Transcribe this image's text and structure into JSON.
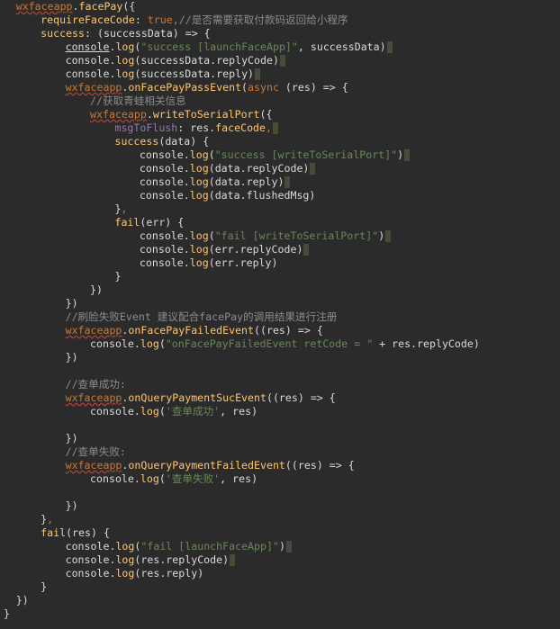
{
  "colors": {
    "background": "#2b2b2b",
    "keyword": "#cc7832",
    "string": "#6a8759",
    "comment": "#8c8c8c",
    "property": "#ffc66d",
    "plain": "#dadada"
  },
  "lines": [
    {
      "indent": 2,
      "tokens": [
        [
          "wxfaceapp",
          "t-obj"
        ],
        [
          ".",
          "t-plain"
        ],
        [
          "facePay",
          "t-prop"
        ],
        [
          "({",
          "t-plain"
        ]
      ]
    },
    {
      "indent": 6,
      "tokens": [
        [
          "requireFaceCode",
          "t-prop"
        ],
        [
          ": ",
          "t-plain"
        ],
        [
          "true",
          "t-kw"
        ],
        [
          ",",
          "t-kw"
        ],
        [
          "//是否需要获取付款码返回给小程序",
          "t-com"
        ]
      ]
    },
    {
      "indent": 6,
      "tokens": [
        [
          "success",
          "t-prop"
        ],
        [
          ": (successData) => {",
          "t-plain"
        ]
      ]
    },
    {
      "indent": 10,
      "tokens": [
        [
          "console",
          "t-consoleu"
        ],
        [
          ".",
          "t-plain"
        ],
        [
          "log",
          "t-prop"
        ],
        [
          "(",
          "t-plain"
        ],
        [
          "\"success [launchFaceApp]\"",
          "t-str"
        ],
        [
          ", successData)",
          "t-plain"
        ]
      ],
      "mark": true
    },
    {
      "indent": 10,
      "tokens": [
        [
          "console",
          "t-console"
        ],
        [
          ".",
          "t-plain"
        ],
        [
          "log",
          "t-prop"
        ],
        [
          "(successData.replyCode)",
          "t-plain"
        ]
      ],
      "mark": true
    },
    {
      "indent": 10,
      "tokens": [
        [
          "console",
          "t-console"
        ],
        [
          ".",
          "t-plain"
        ],
        [
          "log",
          "t-prop"
        ],
        [
          "(successData.reply)",
          "t-plain"
        ]
      ],
      "mark": true
    },
    {
      "indent": 10,
      "tokens": [
        [
          "wxfaceapp",
          "t-obj"
        ],
        [
          ".",
          "t-plain"
        ],
        [
          "onFacePayPassEvent",
          "t-prop"
        ],
        [
          "(",
          "t-plain"
        ],
        [
          "async",
          "t-kw"
        ],
        [
          " (res) => {",
          "t-plain"
        ]
      ]
    },
    {
      "indent": 14,
      "tokens": [
        [
          "//获取青蛙相关信息",
          "t-com"
        ]
      ]
    },
    {
      "indent": 14,
      "tokens": [
        [
          "wxfaceapp",
          "t-obj"
        ],
        [
          ".",
          "t-plain"
        ],
        [
          "writeToSerialPort",
          "t-prop"
        ],
        [
          "({",
          "t-plain"
        ]
      ]
    },
    {
      "indent": 18,
      "tokens": [
        [
          "msgToFlush",
          "t-key"
        ],
        [
          ": res.",
          "t-plain"
        ],
        [
          "faceCode",
          "t-prop"
        ],
        [
          ",",
          "t-kw"
        ]
      ],
      "mark": true
    },
    {
      "indent": 18,
      "tokens": [
        [
          "success",
          "t-prop"
        ],
        [
          "(data) {",
          "t-plain"
        ]
      ]
    },
    {
      "indent": 22,
      "tokens": [
        [
          "console",
          "t-console"
        ],
        [
          ".",
          "t-plain"
        ],
        [
          "log",
          "t-prop"
        ],
        [
          "(",
          "t-plain"
        ],
        [
          "\"success [writeToSerialPort]\"",
          "t-str"
        ],
        [
          ")",
          "t-plain"
        ]
      ],
      "mark": true
    },
    {
      "indent": 22,
      "tokens": [
        [
          "console",
          "t-console"
        ],
        [
          ".",
          "t-plain"
        ],
        [
          "log",
          "t-prop"
        ],
        [
          "(data.replyCode)",
          "t-plain"
        ]
      ],
      "mark": true
    },
    {
      "indent": 22,
      "tokens": [
        [
          "console",
          "t-console"
        ],
        [
          ".",
          "t-plain"
        ],
        [
          "log",
          "t-prop"
        ],
        [
          "(data.reply)",
          "t-plain"
        ]
      ],
      "mark": true
    },
    {
      "indent": 22,
      "tokens": [
        [
          "console",
          "t-console"
        ],
        [
          ".",
          "t-plain"
        ],
        [
          "log",
          "t-prop"
        ],
        [
          "(data.flushedMsg)",
          "t-plain"
        ]
      ]
    },
    {
      "indent": 18,
      "tokens": [
        [
          "}",
          "t-plain"
        ],
        [
          ",",
          "t-kw"
        ]
      ]
    },
    {
      "indent": 18,
      "tokens": [
        [
          "fail",
          "t-prop"
        ],
        [
          "(err) {",
          "t-plain"
        ]
      ]
    },
    {
      "indent": 22,
      "tokens": [
        [
          "console",
          "t-console"
        ],
        [
          ".",
          "t-plain"
        ],
        [
          "log",
          "t-prop"
        ],
        [
          "(",
          "t-plain"
        ],
        [
          "\"fail [writeToSerialPort]\"",
          "t-str"
        ],
        [
          ")",
          "t-plain"
        ]
      ],
      "mark": true
    },
    {
      "indent": 22,
      "tokens": [
        [
          "console",
          "t-console"
        ],
        [
          ".",
          "t-plain"
        ],
        [
          "log",
          "t-prop"
        ],
        [
          "(err.replyCode)",
          "t-plain"
        ]
      ],
      "mark": true
    },
    {
      "indent": 22,
      "tokens": [
        [
          "console",
          "t-console"
        ],
        [
          ".",
          "t-plain"
        ],
        [
          "log",
          "t-prop"
        ],
        [
          "(err.reply)",
          "t-plain"
        ]
      ]
    },
    {
      "indent": 18,
      "tokens": [
        [
          "}",
          "t-plain"
        ]
      ]
    },
    {
      "indent": 14,
      "tokens": [
        [
          "})",
          "t-plain"
        ]
      ]
    },
    {
      "indent": 10,
      "tokens": [
        [
          "})",
          "t-plain"
        ]
      ]
    },
    {
      "indent": 10,
      "tokens": [
        [
          "//刷脸失败Event 建议配合facePay的调用结果进行注册",
          "t-com"
        ]
      ]
    },
    {
      "indent": 10,
      "tokens": [
        [
          "wxfaceapp",
          "t-obj"
        ],
        [
          ".",
          "t-plain"
        ],
        [
          "onFacePayFailedEvent",
          "t-prop"
        ],
        [
          "((res) => {",
          "t-plain"
        ]
      ]
    },
    {
      "indent": 14,
      "tokens": [
        [
          "console",
          "t-console"
        ],
        [
          ".",
          "t-plain"
        ],
        [
          "log",
          "t-prop"
        ],
        [
          "(",
          "t-plain"
        ],
        [
          "\"onFacePayFailedEvent retCode = \"",
          "t-str"
        ],
        [
          " + res.replyCode)",
          "t-plain"
        ]
      ]
    },
    {
      "indent": 10,
      "tokens": [
        [
          "})",
          "t-plain"
        ]
      ]
    },
    {
      "indent": 0,
      "tokens": []
    },
    {
      "indent": 10,
      "tokens": [
        [
          "//查单成功:",
          "t-com"
        ]
      ]
    },
    {
      "indent": 10,
      "tokens": [
        [
          "wxfaceapp",
          "t-obj"
        ],
        [
          ".",
          "t-plain"
        ],
        [
          "onQueryPaymentSucEvent",
          "t-prop"
        ],
        [
          "((res) => {",
          "t-plain"
        ]
      ]
    },
    {
      "indent": 14,
      "tokens": [
        [
          "console",
          "t-console"
        ],
        [
          ".",
          "t-plain"
        ],
        [
          "log",
          "t-prop"
        ],
        [
          "(",
          "t-plain"
        ],
        [
          "'查单成功'",
          "t-str"
        ],
        [
          ", res)",
          "t-plain"
        ]
      ]
    },
    {
      "indent": 0,
      "tokens": []
    },
    {
      "indent": 10,
      "tokens": [
        [
          "})",
          "t-plain"
        ]
      ]
    },
    {
      "indent": 10,
      "tokens": [
        [
          "//查单失败:",
          "t-com"
        ]
      ]
    },
    {
      "indent": 10,
      "tokens": [
        [
          "wxfaceapp",
          "t-obj"
        ],
        [
          ".",
          "t-plain"
        ],
        [
          "onQueryPaymentFailedEvent",
          "t-prop"
        ],
        [
          "((res) => {",
          "t-plain"
        ]
      ]
    },
    {
      "indent": 14,
      "tokens": [
        [
          "console",
          "t-console"
        ],
        [
          ".",
          "t-plain"
        ],
        [
          "log",
          "t-prop"
        ],
        [
          "(",
          "t-plain"
        ],
        [
          "'查单失败'",
          "t-str"
        ],
        [
          ", res)",
          "t-plain"
        ]
      ]
    },
    {
      "indent": 0,
      "tokens": []
    },
    {
      "indent": 10,
      "tokens": [
        [
          "})",
          "t-plain"
        ]
      ]
    },
    {
      "indent": 6,
      "tokens": [
        [
          "}",
          "t-plain"
        ],
        [
          ",",
          "t-kw"
        ]
      ]
    },
    {
      "indent": 6,
      "tokens": [
        [
          "fail",
          "t-prop"
        ],
        [
          "(res) {",
          "t-plain"
        ]
      ]
    },
    {
      "indent": 10,
      "tokens": [
        [
          "console",
          "t-console"
        ],
        [
          ".",
          "t-plain"
        ],
        [
          "log",
          "t-prop"
        ],
        [
          "(",
          "t-plain"
        ],
        [
          "\"fail [launchFaceApp]\"",
          "t-str"
        ],
        [
          ")",
          "t-plain"
        ]
      ],
      "mark": true
    },
    {
      "indent": 10,
      "tokens": [
        [
          "console",
          "t-console"
        ],
        [
          ".",
          "t-plain"
        ],
        [
          "log",
          "t-prop"
        ],
        [
          "(res.replyCode)",
          "t-plain"
        ]
      ],
      "mark": true
    },
    {
      "indent": 10,
      "tokens": [
        [
          "console",
          "t-console"
        ],
        [
          ".",
          "t-plain"
        ],
        [
          "log",
          "t-prop"
        ],
        [
          "(res.reply)",
          "t-plain"
        ]
      ]
    },
    {
      "indent": 6,
      "tokens": [
        [
          "}",
          "t-plain"
        ]
      ]
    },
    {
      "indent": 2,
      "tokens": [
        [
          "})",
          "t-plain"
        ]
      ]
    },
    {
      "indent": 0,
      "tokens": [
        [
          "}",
          "t-plain"
        ]
      ]
    }
  ]
}
